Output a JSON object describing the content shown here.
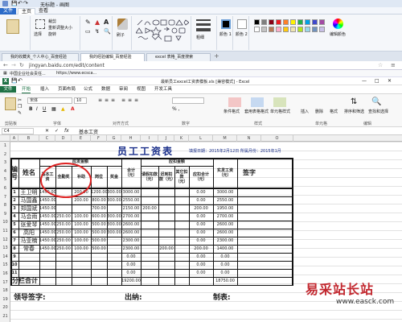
{
  "paint": {
    "title": "无标题 - 画图",
    "tabs": [
      "文件",
      "主页",
      "查看"
    ],
    "labels": {
      "select": "选择",
      "crop": "裁剪",
      "resize": "重新调整大小",
      "rotate": "旋转",
      "brush": "刷子",
      "size": "粗细",
      "color1": "颜色 1",
      "color2": "颜色 2",
      "edit_colors": "编辑颜色"
    },
    "colors": [
      "#000000",
      "#7f7f7f",
      "#880015",
      "#ed1c24",
      "#ff7f27",
      "#fff200",
      "#22b14c",
      "#00a2e8",
      "#3f48cc",
      "#a349a4",
      "#ffffff",
      "#c3c3c3",
      "#b97a57",
      "#ffaec9",
      "#ffc90e",
      "#efe4b0",
      "#b5e61d",
      "#99d9ea",
      "#7092be",
      "#c8bfe7"
    ]
  },
  "browser": {
    "tabs": [
      "我的收藏夹_个人中心_百度经验",
      "我的经验编辑_百度经验",
      "excel 表格_百度搜索"
    ],
    "address": "jingyan.baidu.com/edit/content",
    "bookmarks": [
      "中国企业社会责任...",
      "https://www.ecsca..."
    ]
  },
  "excel": {
    "title": "最新员工excel工资表模板.xls [兼容模式] - Excel",
    "tabs": [
      "文件",
      "开始",
      "插入",
      "页面布局",
      "公式",
      "数据",
      "审阅",
      "视图",
      "开发工具"
    ],
    "font_name": "宋体",
    "font_size": "10",
    "groups": [
      "剪贴板",
      "字体",
      "对齐方式",
      "数字",
      "样式",
      "单元格",
      "编辑"
    ],
    "styles": [
      "条件格式",
      "套用表格格式",
      "单元格样式"
    ],
    "cells_btns": [
      "插入",
      "删除",
      "格式"
    ],
    "edit_btns": [
      "排序和筛选",
      "查找和选择"
    ],
    "name_box": "C4",
    "formula": "基本工资",
    "fx": "fx",
    "columns": [
      "A",
      "B",
      "C",
      "D",
      "E",
      "F",
      "G",
      "H",
      "I",
      "J",
      "K",
      "L",
      "M",
      "N",
      "O"
    ],
    "rows": [
      "1",
      "2",
      "3",
      "4",
      "5",
      "6",
      "7",
      "8",
      "9",
      "10",
      "11",
      "12",
      "13",
      "14",
      "15",
      "16",
      "17",
      "18",
      "19",
      "20",
      "21"
    ]
  },
  "sheet": {
    "title": "员工工资表",
    "date_line": "填报日期：2015年2月12日  所属月份：2015年1月",
    "h_number": "编号",
    "h_name": "姓名",
    "h_payable": "应发金额",
    "h_deduct": "应扣金额",
    "h_cols": [
      "基本工资",
      "全勤奖",
      "补助",
      "岗位",
      "奖金",
      "合计（元）",
      "请假扣款（元）",
      "迟到扣款（元）",
      "其它扣款（元）",
      "应扣合计（元）",
      "实发工资（元）",
      "签字"
    ],
    "rows": [
      {
        "no": "1",
        "name": "王卫明",
        "v": [
          "1450.00",
          "",
          "200.00",
          "1200.00",
          "300.00",
          "3000.00",
          "",
          "",
          "",
          "0.00",
          "3000.00"
        ]
      },
      {
        "no": "2",
        "name": "马国鑫",
        "v": [
          "1450.00",
          "",
          "200.00",
          "800.00",
          "300.00",
          "2550.00",
          "",
          "",
          "",
          "0.00",
          "2550.00"
        ]
      },
      {
        "no": "3",
        "name": "郑国斌",
        "v": [
          "1450.00",
          "",
          "",
          "700.00",
          "",
          "2150.00",
          "200.00",
          "",
          "",
          "200.00",
          "1950.00"
        ]
      },
      {
        "no": "4",
        "name": "马会雨",
        "v": [
          "1450.00",
          "250.00",
          "100.00",
          "600.00",
          "300.00",
          "2700.00",
          "",
          "",
          "",
          "0.00",
          "2700.00"
        ]
      },
      {
        "no": "5",
        "name": "张爱琴",
        "v": [
          "1450.00",
          "250.00",
          "100.00",
          "500.00",
          "300.00",
          "2600.00",
          "",
          "",
          "",
          "0.00",
          "2600.00"
        ]
      },
      {
        "no": "6",
        "name": "高阳",
        "v": [
          "1450.00",
          "250.00",
          "100.00",
          "500.00",
          "300.00",
          "2600.00",
          "",
          "",
          "",
          "0.00",
          "2600.00"
        ]
      },
      {
        "no": "7",
        "name": "马亚楠",
        "v": [
          "1450.00",
          "250.00",
          "100.00",
          "500.00",
          "",
          "2300.00",
          "",
          "",
          "",
          "0.00",
          "2300.00"
        ]
      },
      {
        "no": "8",
        "name": "常春",
        "v": [
          "1450.00",
          "250.00",
          "100.00",
          "500.00",
          "",
          "2300.00",
          "",
          "200.00",
          "",
          "200.00",
          "1400.00"
        ]
      },
      {
        "no": "9",
        "name": "",
        "v": [
          "",
          "",
          "",
          "",
          "",
          "0.00",
          "",
          "",
          "",
          "0.00",
          "0.00"
        ]
      },
      {
        "no": "10",
        "name": "",
        "v": [
          "",
          "",
          "",
          "",
          "",
          "0.00",
          "",
          "",
          "",
          "0.00",
          "0.00"
        ]
      },
      {
        "no": "11",
        "name": "",
        "v": [
          "",
          "",
          "",
          "",
          "",
          "0.00",
          "",
          "",
          "",
          "0.00",
          "0.00"
        ]
      }
    ],
    "total_label": "分栏合计",
    "total_sum": "19200.00",
    "total_net": "18750.00",
    "sig_leader": "领导签字:",
    "sig_cashier": "出纳:",
    "sig_maker": "制表:"
  },
  "watermark": {
    "text": "易采站长站",
    "url": "www.easck.com"
  }
}
